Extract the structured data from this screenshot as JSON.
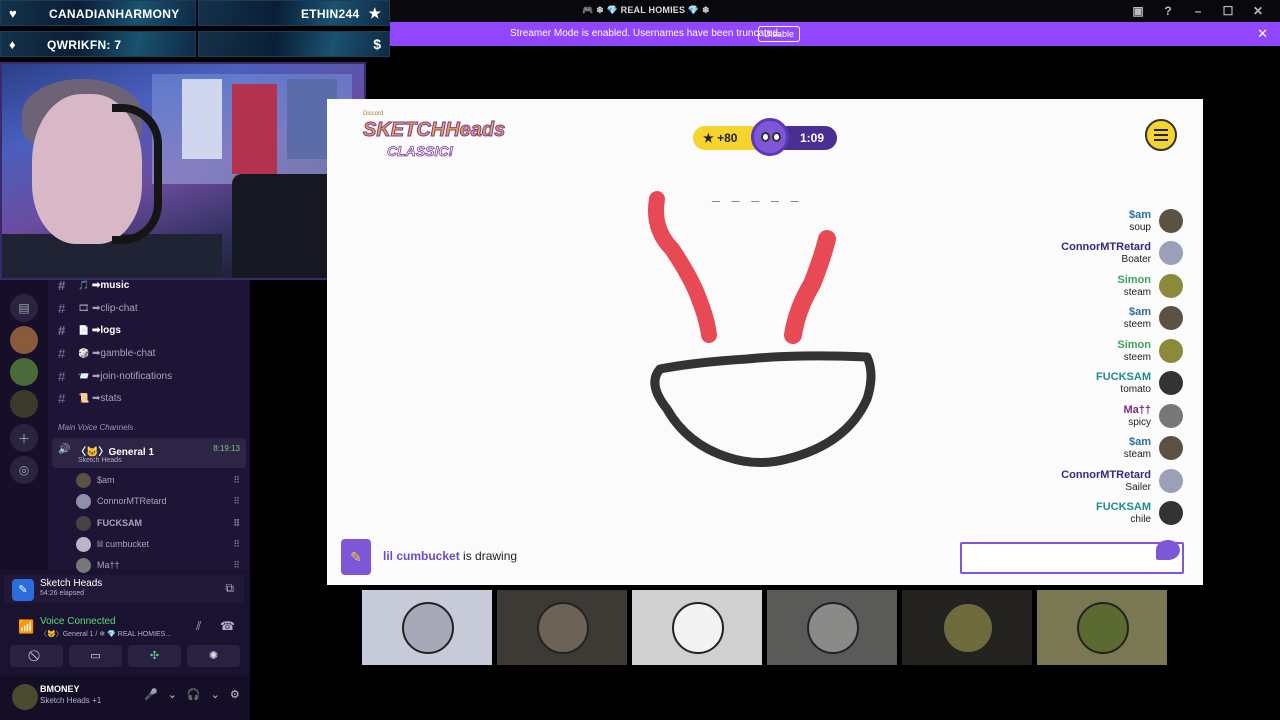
{
  "titlebar": {
    "title": "🎮 ❄ 💎 REAL HOMIES 💎 ❄",
    "icons": [
      "▣",
      "?",
      "–",
      "☐",
      "✕"
    ]
  },
  "banner": {
    "text": "Streamer Mode is enabled. Usernames have been truncated.",
    "button": "Disable",
    "close": "✕"
  },
  "alerts": [
    {
      "icon": "♥",
      "text": "CANADIANHARMONY"
    },
    {
      "icon_right": "★",
      "text": "ETHIN244"
    },
    {
      "icon": "♦",
      "text": "QWRIKFN: 7"
    },
    {
      "icon_right": "$",
      "text": ""
    }
  ],
  "discord": {
    "channels": [
      {
        "emo": "🎵",
        "label": "➡music",
        "bold": true
      },
      {
        "emo": "🎞",
        "label": "➡clip-chat",
        "bold": false
      },
      {
        "emo": "📄",
        "label": "➡logs",
        "bold": true
      },
      {
        "emo": "🎲",
        "label": "➡gamble-chat",
        "bold": false
      },
      {
        "emo": "📨",
        "label": "➡join-notifications",
        "bold": false
      },
      {
        "emo": "📜",
        "label": "➡stats",
        "bold": false
      }
    ],
    "category": "Main Voice Channels",
    "voice_channel": {
      "name": "〈🐱〉General 1",
      "sub": "Sketch Heads",
      "time": "8:19:13"
    },
    "voice_users": [
      "$am",
      "ConnorMTRetard",
      "FUCKSAM",
      "lil cumbucket",
      "Ma††"
    ],
    "activity": {
      "title": "Sketch Heads",
      "sub": "54:26 elapsed"
    },
    "voice_connected": {
      "title": "Voice Connected",
      "sub": "〈🐱〉General 1 / ❄ 💎 REAL HOMIES..."
    },
    "user": {
      "name": "BMONEY",
      "sub": "Sketch Heads +1"
    }
  },
  "game": {
    "logo": {
      "main": "SKETCHHeads",
      "sub": "CLASSIC!",
      "tiny": "Discord"
    },
    "points": "★ +80",
    "time": "1:09",
    "blanks": "_ _ _ _ _",
    "guesses": [
      {
        "name": "$am",
        "text": "soup",
        "color": "#2e6f9e"
      },
      {
        "name": "ConnorMTRetard",
        "text": "Boater",
        "color": "#3a2780"
      },
      {
        "name": "Simon",
        "text": "steam",
        "color": "#3aa655"
      },
      {
        "name": "$am",
        "text": "steem",
        "color": "#2e6f9e"
      },
      {
        "name": "Simon",
        "text": "steem",
        "color": "#3aa655"
      },
      {
        "name": "FUCKSAM",
        "text": "tomato",
        "color": "#1f8c8c"
      },
      {
        "name": "Ma††",
        "text": "spicy",
        "color": "#7a2a8c"
      },
      {
        "name": "$am",
        "text": "steam",
        "color": "#2e6f9e"
      },
      {
        "name": "ConnorMTRetard",
        "text": "Sailer",
        "color": "#3a2780"
      },
      {
        "name": "FUCKSAM",
        "text": "chile",
        "color": "#1f8c8c"
      }
    ],
    "drawer": "lil cumbucket",
    "drawing_suffix": " is drawing",
    "input_placeholder": ""
  },
  "tiles_count": 6
}
